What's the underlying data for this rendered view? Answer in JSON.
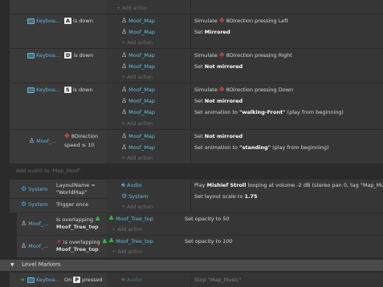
{
  "ev0": {
    "add_action": "Add action"
  },
  "ev1": {
    "cond_object": "Keyboa...",
    "cond_key": "A",
    "cond_suffix": "is down",
    "actions": [
      {
        "object": "Moof_Map",
        "pre": "Simulate",
        "icon_obj": "8Direction",
        "post": "pressing Left"
      },
      {
        "object": "Moof_Map",
        "pre": "Set",
        "bold": "Mirrored"
      }
    ],
    "add_action": "Add action"
  },
  "ev2": {
    "cond_object": "Keyboa...",
    "cond_key": "D",
    "cond_suffix": "is down",
    "actions": [
      {
        "object": "Moof_Map",
        "pre": "Simulate",
        "icon_obj": "8Direction",
        "post": "pressing Right"
      },
      {
        "object": "Moof_Map",
        "pre": "Set",
        "bold": "Not mirrored"
      }
    ],
    "add_action": "Add action"
  },
  "ev3": {
    "cond_object": "Keyboa...",
    "cond_key": "S",
    "cond_suffix": "is down",
    "actions": [
      {
        "object": "Moof_Map",
        "pre": "Simulate",
        "icon_obj": "8Direction",
        "post": "pressing Down"
      },
      {
        "object": "Moof_Map",
        "pre": "Set",
        "bold": "Not mirrored"
      },
      {
        "object": "Moof_Map",
        "pre": "Set animation to",
        "bold": "\"walking-Front\"",
        "post": "(play from beginning)"
      }
    ],
    "add_action": "Add action"
  },
  "ev4": {
    "cond_object": "Moof_...",
    "cond_behavior": "8Direction",
    "cond_line2": "speed ≤ 10",
    "actions": [
      {
        "object": "Moof_Map",
        "pre": "Set",
        "bold": "Not mirrored"
      },
      {
        "object": "Moof_Map",
        "pre": "Set animation to",
        "bold": "\"standing\"",
        "post": "(play from beginning)"
      }
    ],
    "add_action": "Add action"
  },
  "add_event": "Add event to 'Map_Moof'",
  "ev5": {
    "conds": [
      {
        "object": "System",
        "line1": "LayoutName =",
        "line2": "\"WorldMap\""
      },
      {
        "object": "System",
        "line1": "Trigger once"
      }
    ],
    "actions": [
      {
        "object": "Audio",
        "pre": "Play",
        "bold": "Mishief Stroll",
        "post": "looping at volume -2 dB (stereo pan 0, tag \"Map_Music\")"
      },
      {
        "object": "System",
        "pre": "Set layout scale to",
        "bold": "1.75"
      }
    ],
    "add_action": "Add action"
  },
  "ev6": {
    "cond_object": "Moof_...",
    "cond_line1": "Is overlapping",
    "cond_line2": "Moof_Tree_top",
    "actions": [
      {
        "object": "Moof_Tree_top",
        "pre": "Set opacity to",
        "ital": "50"
      }
    ],
    "add_action": "Add action"
  },
  "ev7": {
    "cond_object": "Moof_...",
    "cond_line1": "is overlapping",
    "cond_line2": "Moof_Tree_top",
    "actions": [
      {
        "object": "Moof_Tree_top",
        "pre": "Set opacity to",
        "ital": "100"
      }
    ],
    "add_action": "Add action"
  },
  "group": {
    "title": "Level Markers"
  },
  "ev8": {
    "cond_object": "Keyboa...",
    "cond_pre": "On",
    "cond_key": "P",
    "cond_suffix": "pressed",
    "action_object": "Audio",
    "action_text": "Stop \"Map_Music\""
  },
  "colors": {
    "background": "#2b2b2b",
    "object_blue": "#5fb5e0",
    "group_bar": "#4a4a4a"
  }
}
